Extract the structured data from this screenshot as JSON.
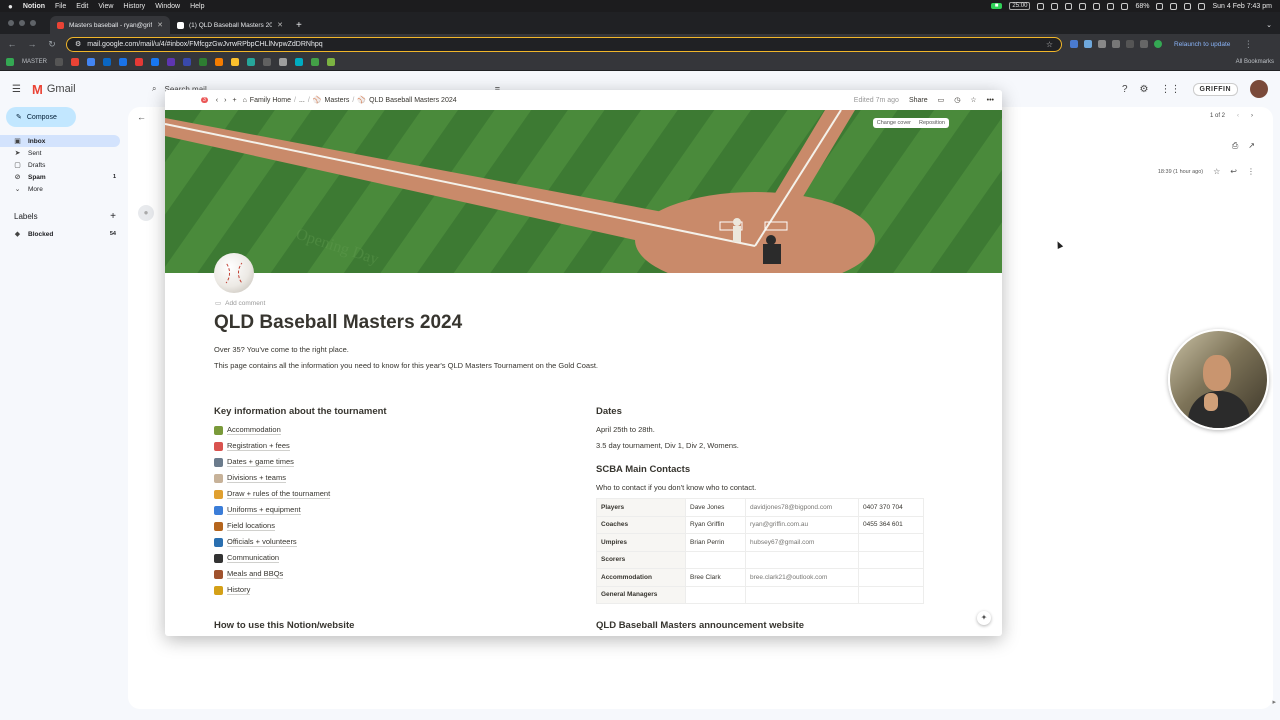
{
  "menubar": {
    "app": "Notion",
    "items": [
      "File",
      "Edit",
      "View",
      "History",
      "Window",
      "Help"
    ],
    "timer": "25:00",
    "battery": "68%",
    "datetime": "Sun 4 Feb  7:43 pm"
  },
  "tabs": [
    {
      "title": "Masters baseball - ryan@griffi",
      "active": true
    },
    {
      "title": "(1) QLD Baseball Masters 20",
      "active": false
    }
  ],
  "toolbar": {
    "url": "mail.google.com/mail/u/4/#inbox/FMfcgzGwJvrwRPbpCHLlNvpwZdDRNhpq",
    "relaunch": "Relaunch to update"
  },
  "bookmarks": {
    "first": "MASTER",
    "all": "All Bookmarks"
  },
  "gmail": {
    "logo": "Gmail",
    "search_placeholder": "Search mail",
    "compose": "Compose",
    "nav": [
      {
        "label": "Inbox",
        "count": "",
        "active": true,
        "icon": "inbox-icon"
      },
      {
        "label": "Sent",
        "count": "",
        "active": false,
        "icon": "send-icon"
      },
      {
        "label": "Drafts",
        "count": "",
        "active": false,
        "icon": "draft-icon"
      },
      {
        "label": "Spam",
        "count": "1",
        "active": false,
        "icon": "spam-icon"
      },
      {
        "label": "More",
        "count": "",
        "active": false,
        "icon": "chevron-down-icon"
      }
    ],
    "labels_title": "Labels",
    "labels": [
      {
        "label": "Blocked",
        "count": "54"
      }
    ],
    "brand": "GRIFFIN",
    "pager": "1 of 2",
    "timestamp": "18:39 (1 hour ago)"
  },
  "notion": {
    "notification_count": "3",
    "breadcrumb": [
      "Family Home",
      "...",
      "Masters",
      "QLD Baseball Masters 2024"
    ],
    "edited": "Edited 7m ago",
    "share": "Share",
    "change_cover": "Change cover",
    "reposition": "Reposition",
    "add_comment": "Add comment",
    "title": "QLD Baseball Masters 2024",
    "intro_line1": "Over 35? You've come to the right place.",
    "intro_line2": "This page contains all the information you need to know for this year's QLD Masters Tournament on the Gold Coast.",
    "key_info_heading": "Key information about the tournament",
    "key_info_items": [
      {
        "label": "Accommodation",
        "color": "#7a9a3a"
      },
      {
        "label": "Registration + fees",
        "color": "#d9534f"
      },
      {
        "label": "Dates + game times",
        "color": "#6b7b8c"
      },
      {
        "label": "Divisions + teams",
        "color": "#c7b299"
      },
      {
        "label": "Draw + rules of the tournament",
        "color": "#e0a030"
      },
      {
        "label": "Uniforms + equipment",
        "color": "#3b7dd8"
      },
      {
        "label": "Field locations",
        "color": "#b5651d"
      },
      {
        "label": "Officials + volunteers",
        "color": "#2a6fb0"
      },
      {
        "label": "Communication",
        "color": "#333333"
      },
      {
        "label": "Meals and BBQs",
        "color": "#a0522d"
      },
      {
        "label": "History",
        "color": "#d4a017"
      }
    ],
    "dates_heading": "Dates",
    "dates_line1": "April 25th to 28th.",
    "dates_line2": "3.5 day tournament, Div 1, Div 2, Womens.",
    "contacts_heading": "SCBA Main Contacts",
    "contacts_sub": "Who to contact if you don't know who to contact.",
    "contacts": [
      {
        "role": "Players",
        "name": "Dave Jones",
        "email": "davidjones78@bigpond.com",
        "phone": "0407 370 704"
      },
      {
        "role": "Coaches",
        "name": "Ryan Griffin",
        "email": "ryan@griffin.com.au",
        "phone": "0455 364 601"
      },
      {
        "role": "Umpires",
        "name": "Brian Perrin",
        "email": "hubsey67@gmail.com",
        "phone": ""
      },
      {
        "role": "Scorers",
        "name": "",
        "email": "",
        "phone": ""
      },
      {
        "role": "Accommodation",
        "name": "Bree Clark",
        "email": "bree.clark21@outlook.com",
        "phone": ""
      },
      {
        "role": "General Managers",
        "name": "",
        "email": "",
        "phone": ""
      }
    ],
    "bottom_left_heading": "How to use this Notion/website",
    "bottom_right_heading": "QLD Baseball Masters announcement website"
  }
}
